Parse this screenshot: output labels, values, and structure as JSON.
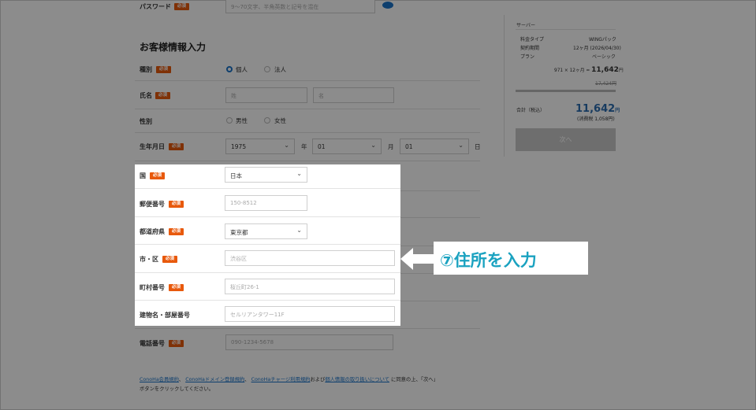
{
  "form": {
    "password_label": "パスワード",
    "password_placeholder": "9～70文字、半角英数と記号を混在",
    "section_title": "お客様情報入力",
    "required": "必須",
    "type_label": "種別",
    "type_options": [
      "個人",
      "法人"
    ],
    "name_label": "氏名",
    "last_name_placeholder": "姓",
    "first_name_placeholder": "名",
    "gender_label": "性別",
    "gender_options": [
      "男性",
      "女性"
    ],
    "birth_label": "生年月日",
    "birth_year": "1975",
    "birth_month": "01",
    "birth_day": "01",
    "year_unit": "年",
    "month_unit": "月",
    "day_unit": "日",
    "country_label": "国",
    "country_value": "日本",
    "zip_label": "郵便番号",
    "zip_placeholder": "150-8512",
    "pref_label": "都道府県",
    "pref_value": "東京都",
    "city_label": "市・区",
    "city_placeholder": "渋谷区",
    "town_label": "町村番号",
    "town_placeholder": "桜丘町26-1",
    "building_label": "建物名・部屋番号",
    "building_placeholder": "セルリアンタワー11F",
    "phone_label": "電話番号",
    "phone_placeholder": "090-1234-5678"
  },
  "terms": {
    "link1": "ConoHa会員規約",
    "sep1": "、",
    "link2": "ConoHaドメイン登録規約",
    "sep2": "、",
    "link3": "ConoHaチャージ利用規約",
    "and": "および",
    "link4": "個人情報の取り扱いについて",
    "tail": "に同意の上、「次へ」",
    "line2": "ボタンをクリックしてください。"
  },
  "summary": {
    "heading": "サーバー",
    "rows": [
      {
        "k": "料金タイプ",
        "v": "WINGパック"
      },
      {
        "k": "契約期間",
        "v": "12ヶ月 (2026/04/30)"
      },
      {
        "k": "プラン",
        "v": "ベーシック"
      }
    ],
    "calc_prefix": "971 × 12ヶ月 = ",
    "calc_total": "11,642",
    "calc_unit": "円",
    "strike_price": "17,424円",
    "total_label": "合計（税込）",
    "total_value": "11,642",
    "total_unit": "円",
    "tax_note": "(消費税 1,058円)",
    "next_button": "次へ"
  },
  "callout": {
    "text": "⑦住所を入力"
  },
  "colors": {
    "required_badge": "#e8590c",
    "link": "#1a73c8",
    "callout_text": "#1aa2c0",
    "price": "#2b6cb0"
  }
}
